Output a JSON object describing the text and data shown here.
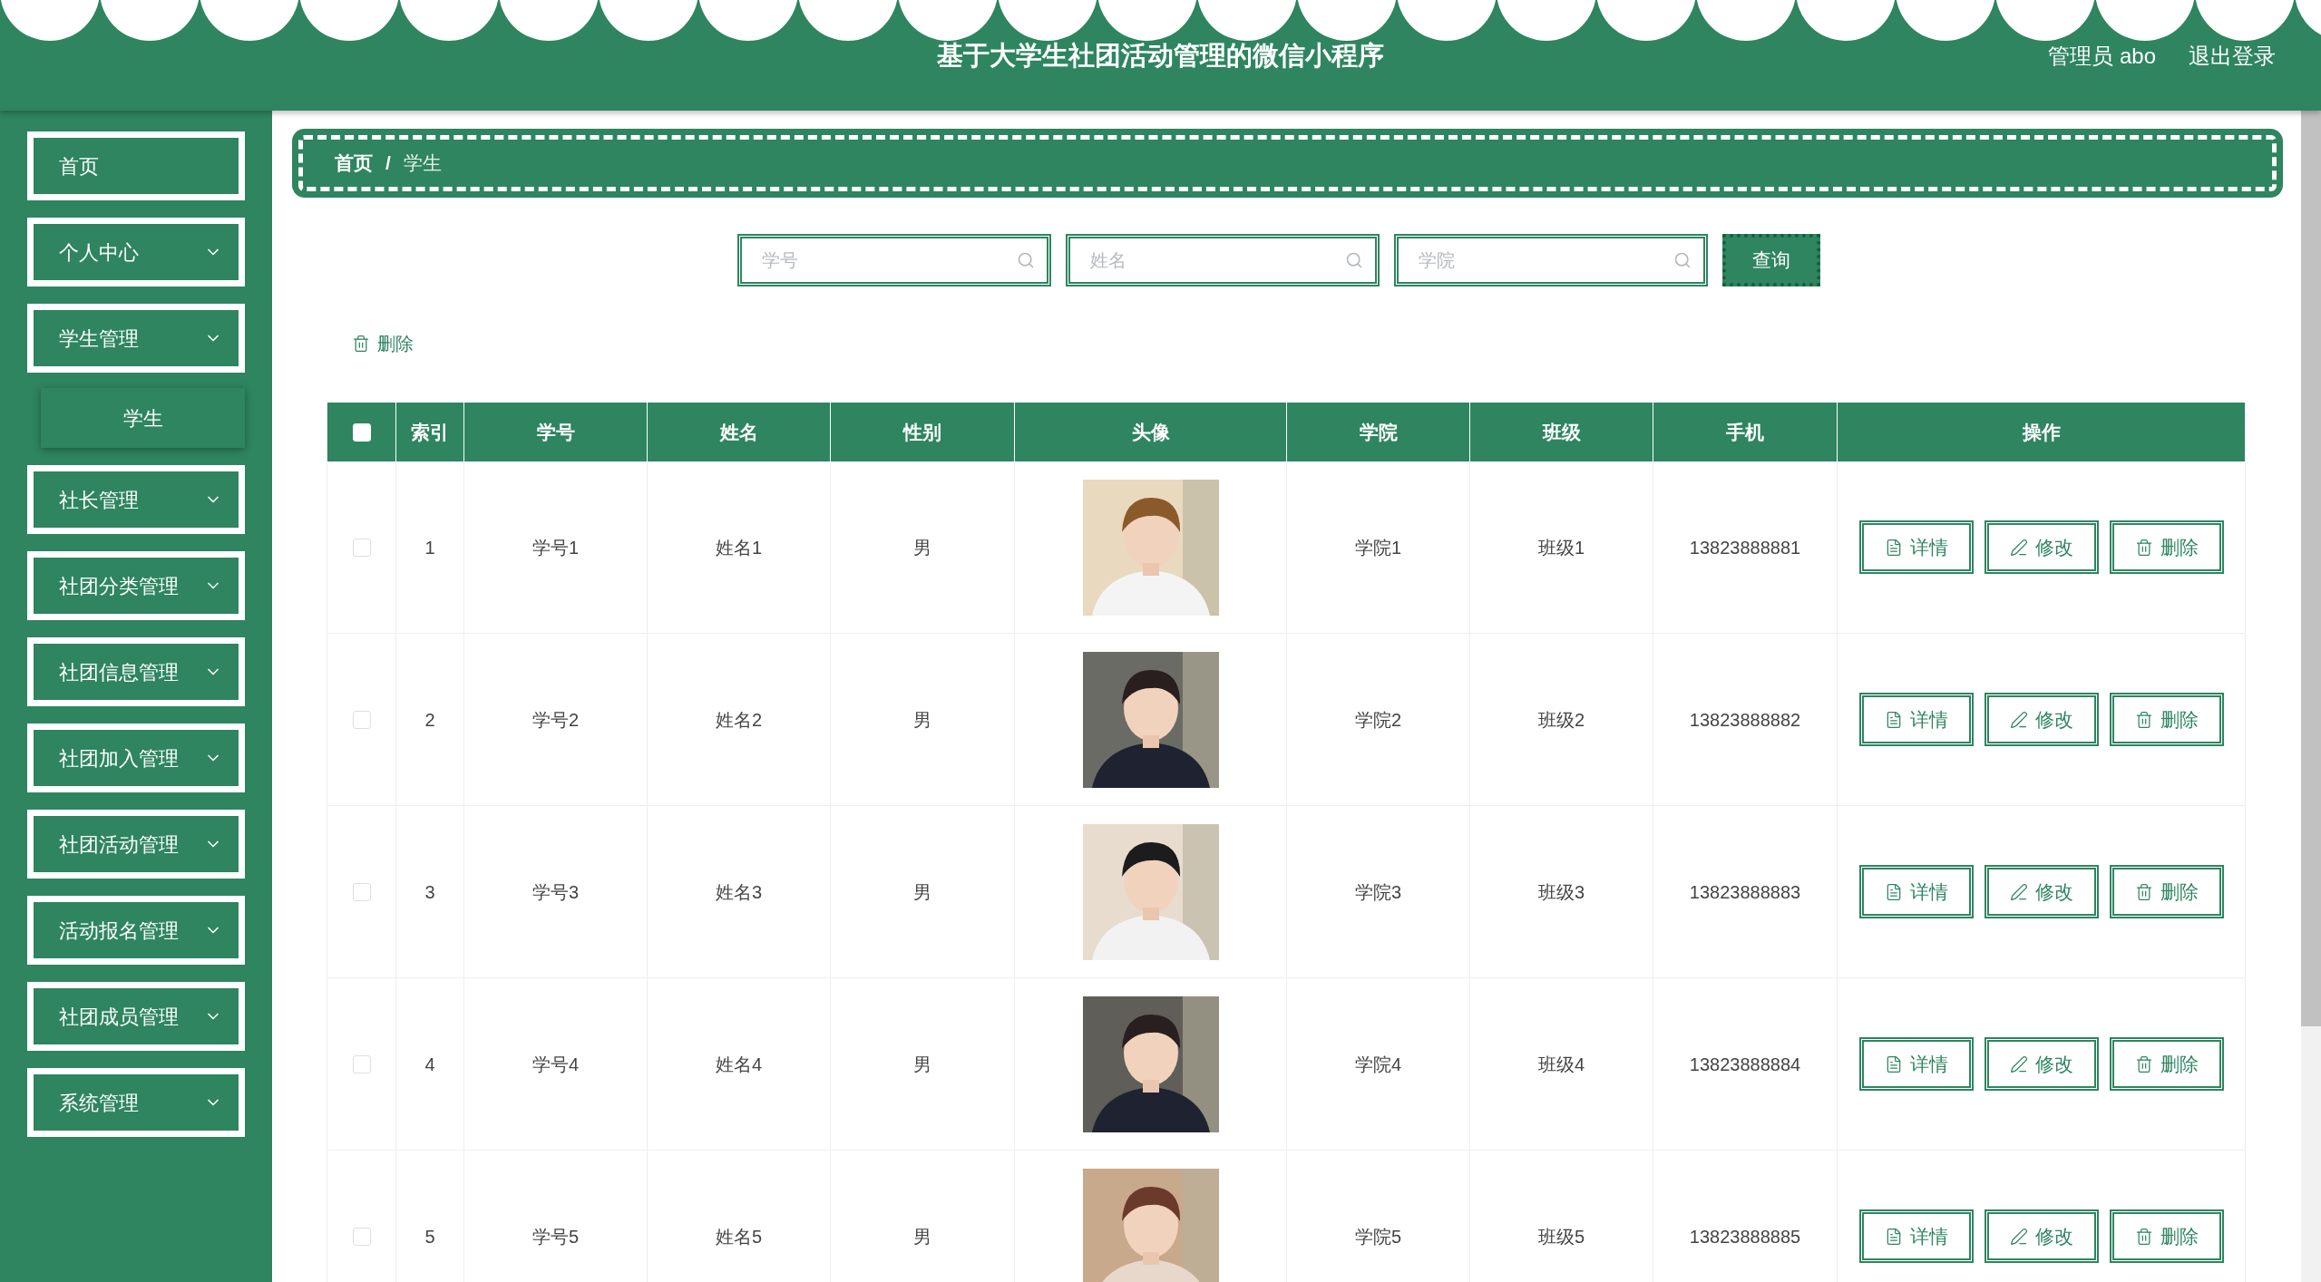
{
  "header": {
    "title": "基于大学生社团活动管理的微信小程序",
    "user": "管理员 abo",
    "logout": "退出登录"
  },
  "sidebar": {
    "items": [
      {
        "label": "首页",
        "kind": "link"
      },
      {
        "label": "个人中心",
        "kind": "menu"
      },
      {
        "label": "学生管理",
        "kind": "menu",
        "children": [
          {
            "label": "学生",
            "selected": true
          }
        ]
      },
      {
        "label": "社长管理",
        "kind": "menu"
      },
      {
        "label": "社团分类管理",
        "kind": "menu"
      },
      {
        "label": "社团信息管理",
        "kind": "menu"
      },
      {
        "label": "社团加入管理",
        "kind": "menu"
      },
      {
        "label": "社团活动管理",
        "kind": "menu"
      },
      {
        "label": "活动报名管理",
        "kind": "menu"
      },
      {
        "label": "社团成员管理",
        "kind": "menu"
      },
      {
        "label": "系统管理",
        "kind": "menu"
      }
    ]
  },
  "breadcrumb": [
    "首页",
    "学生"
  ],
  "breadcrumb_separator": "/",
  "search": {
    "fields": [
      {
        "placeholder": "学号"
      },
      {
        "placeholder": "姓名"
      },
      {
        "placeholder": "学院"
      }
    ],
    "button": "查询"
  },
  "toolbar": {
    "delete": "删除"
  },
  "table": {
    "select_all": {
      "checked": false
    },
    "columns": [
      "索引",
      "学号",
      "姓名",
      "性别",
      "头像",
      "学院",
      "班级",
      "手机",
      "操作"
    ],
    "rows": [
      {
        "checked": false,
        "cells": [
          "1",
          "学号1",
          "姓名1",
          "男",
          "",
          "学院1",
          "班级1",
          "13823888881"
        ],
        "actions": [
          {
            "kind": "detail",
            "label": "详情"
          },
          {
            "kind": "edit",
            "label": "修改"
          },
          {
            "kind": "delete",
            "label": "删除"
          }
        ]
      },
      {
        "checked": false,
        "cells": [
          "2",
          "学号2",
          "姓名2",
          "男",
          "",
          "学院2",
          "班级2",
          "13823888882"
        ],
        "actions": [
          {
            "kind": "detail",
            "label": "详情"
          },
          {
            "kind": "edit",
            "label": "修改"
          },
          {
            "kind": "delete",
            "label": "删除"
          }
        ]
      },
      {
        "checked": false,
        "cells": [
          "3",
          "学号3",
          "姓名3",
          "男",
          "",
          "学院3",
          "班级3",
          "13823888883"
        ],
        "actions": [
          {
            "kind": "detail",
            "label": "详情"
          },
          {
            "kind": "edit",
            "label": "修改"
          },
          {
            "kind": "delete",
            "label": "删除"
          }
        ]
      },
      {
        "checked": false,
        "cells": [
          "4",
          "学号4",
          "姓名4",
          "男",
          "",
          "学院4",
          "班级4",
          "13823888884"
        ],
        "actions": [
          {
            "kind": "detail",
            "label": "详情"
          },
          {
            "kind": "edit",
            "label": "修改"
          },
          {
            "kind": "delete",
            "label": "删除"
          }
        ]
      },
      {
        "checked": false,
        "cells": [
          "5",
          "学号5",
          "姓名5",
          "男",
          "",
          "学院5",
          "班级5",
          "13823888885"
        ],
        "actions": [
          {
            "kind": "detail",
            "label": "详情"
          },
          {
            "kind": "edit",
            "label": "修改"
          },
          {
            "kind": "delete",
            "label": "删除"
          }
        ]
      }
    ]
  }
}
